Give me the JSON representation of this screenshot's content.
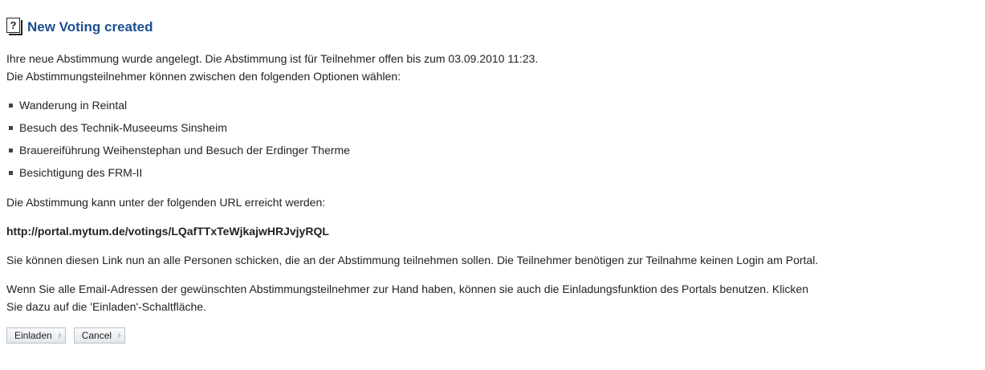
{
  "header": {
    "icon": "help-icon",
    "icon_glyph": "?",
    "title": "New Voting created"
  },
  "intro": {
    "line1": "Ihre neue Abstimmung wurde angelegt. Die Abstimmung ist für Teilnehmer offen bis zum 03.09.2010 11:23.",
    "line2": "Die Abstimmungsteilnehmer können zwischen den folgenden Optionen wählen:"
  },
  "options": [
    "Wanderung in Reintal",
    "Besuch des Technik-Museeums Sinsheim",
    "Brauereiführung Weihenstephan und Besuch der Erdinger Therme",
    "Besichtigung des FRM-II"
  ],
  "url_intro": "Die Abstimmung kann unter der folgenden URL erreicht werden:",
  "url": "http://portal.mytum.de/votings/LQafTTxTeWjkajwHRJvjyRQL",
  "share_text": "Sie können diesen Link nun an alle Personen schicken, die an der Abstimmung teilnehmen sollen. Die Teilnehmer benötigen zur Teilnahme keinen Login am Portal.",
  "invite_text": {
    "line1": "Wenn Sie alle Email-Adressen der gewünschten Abstimmungsteilnehmer zur Hand haben, können sie auch die Einladungsfunktion des Portals benutzen. Klicken",
    "line2": "Sie dazu auf die 'Einladen'-Schaltfläche."
  },
  "buttons": {
    "invite_label": "Einladen",
    "cancel_label": "Cancel"
  },
  "colors": {
    "title": "#1b4f8f",
    "text": "#222222"
  }
}
